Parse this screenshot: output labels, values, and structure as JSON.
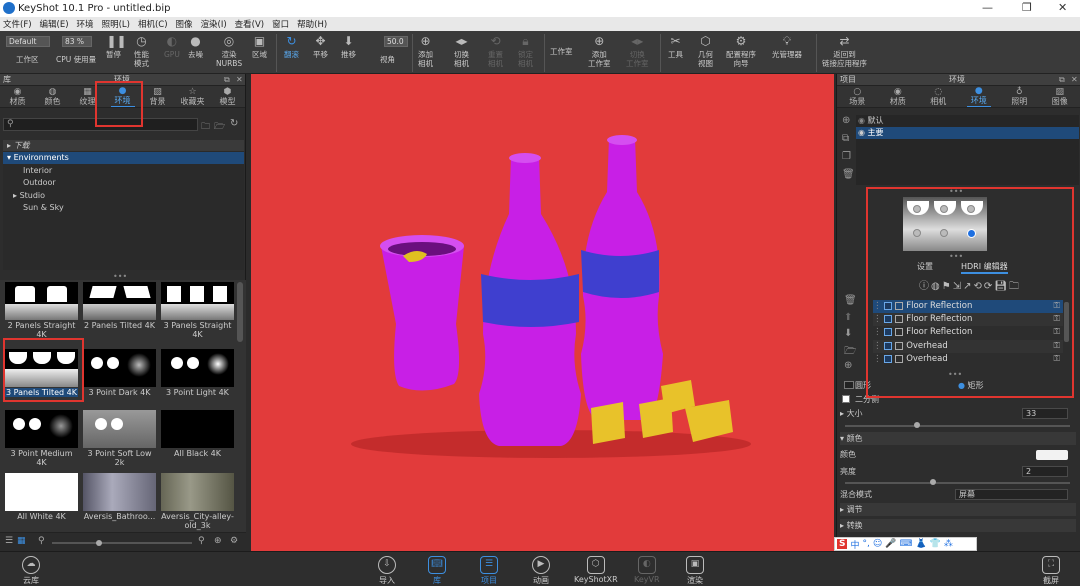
{
  "window": {
    "title": "KeyShot 10.1 Pro  - untitled.bip",
    "min": "—",
    "max": "❐",
    "close": "✕"
  },
  "menu": [
    "文件(F)",
    "编辑(E)",
    "环境",
    "照明(L)",
    "相机(C)",
    "图像",
    "渲染(I)",
    "查看(V)",
    "窗口",
    "帮助(H)"
  ],
  "toolbar": {
    "workspace_value": "Default",
    "workspace_label": "工作区",
    "cpu_value": "83 %",
    "cpu_label": "CPU 使用量",
    "pause": "暂停",
    "perf1": "性能",
    "perf2": "模式",
    "gpu": "GPU",
    "denoise": "去噪",
    "nurbs1": "渲染",
    "nurbs2": "NURBS",
    "region": "区域",
    "refresh": "翻滚",
    "pan": "平移",
    "dolly": "推移",
    "fov_value": "50.0",
    "fov_label": "视角",
    "add_cam1": "添加",
    "add_cam2": "相机",
    "switch_cam1": "切换",
    "switch_cam2": "相机",
    "reset_cam1": "重置",
    "reset_cam2": "相机",
    "lock_cam1": "锁定",
    "lock_cam2": "相机",
    "studio": "工作室",
    "add_studio1": "添加",
    "add_studio2": "工作室",
    "switch_studio1": "切换",
    "switch_studio2": "工作室",
    "tools": "工具",
    "geo1": "几何",
    "geo2": "视图",
    "config1": "配置程序",
    "config2": "向导",
    "light_mgr": "光管理器",
    "link1": "返回到",
    "link2": "链接应用程序"
  },
  "library": {
    "header": "库",
    "panel_title": "环境",
    "tabs": [
      "材质",
      "颜色",
      "纹理",
      "环境",
      "背景",
      "收藏夹",
      "模型"
    ],
    "tree": [
      {
        "label": "下载"
      },
      {
        "label": "Environments"
      },
      {
        "label": "Interior"
      },
      {
        "label": "Outdoor"
      },
      {
        "label": "Studio"
      },
      {
        "label": "Sun & Sky"
      }
    ],
    "thumbs": [
      "2 Panels Straight 4K",
      "2 Panels Tilted 4K",
      "3 Panels Straight 4K",
      "3 Panels Tilted 4K",
      "3 Point Dark 4K",
      "3 Point Light 4K",
      "3 Point Medium 4K",
      "3 Point Soft Low 2k",
      "All Black 4K",
      "All White 4K",
      "Aversis_Bathroo...",
      "Aversis_City-alley-old_3k"
    ]
  },
  "project": {
    "header": "项目",
    "panel_title": "环境",
    "tabs": [
      "场景",
      "材质",
      "相机",
      "环境",
      "照明",
      "图像"
    ],
    "envs": [
      "默认",
      "主要"
    ],
    "sub_tabs": {
      "settings": "设置",
      "editor": "HDRI 编辑器"
    },
    "layers": [
      "Floor Reflection",
      "Floor Reflection",
      "Floor Reflection",
      "Overhead",
      "Overhead"
    ],
    "shape_label": "矩形",
    "props": {
      "circle": "圆形",
      "two_side": "二分侧",
      "size_label": "大小",
      "size_value": "33",
      "color_section": "颜色",
      "color_label": "颜色",
      "brightness_label": "亮度",
      "brightness_value": "2",
      "blend_label": "混合模式",
      "blend_value": "屏幕",
      "adjust": "调节",
      "transform": "转换"
    }
  },
  "bottom": {
    "cloud": "云库",
    "import": "导入",
    "library": "库",
    "project": "项目",
    "animation": "动画",
    "keyshotxr": "KeyShotXR",
    "keyvr": "KeyVR",
    "render": "渲染",
    "screenshot": "截屏"
  },
  "ime": [
    "中",
    "°,",
    "☺",
    "🎤",
    "⌨",
    "👗",
    "👕",
    "⁂"
  ],
  "colors": {
    "viewport_bg": "#e23b3b",
    "bottle": "#c81fe6",
    "label": "#3f3fcf",
    "accent": "#3d8fe0",
    "highlight": "#e0352f"
  }
}
